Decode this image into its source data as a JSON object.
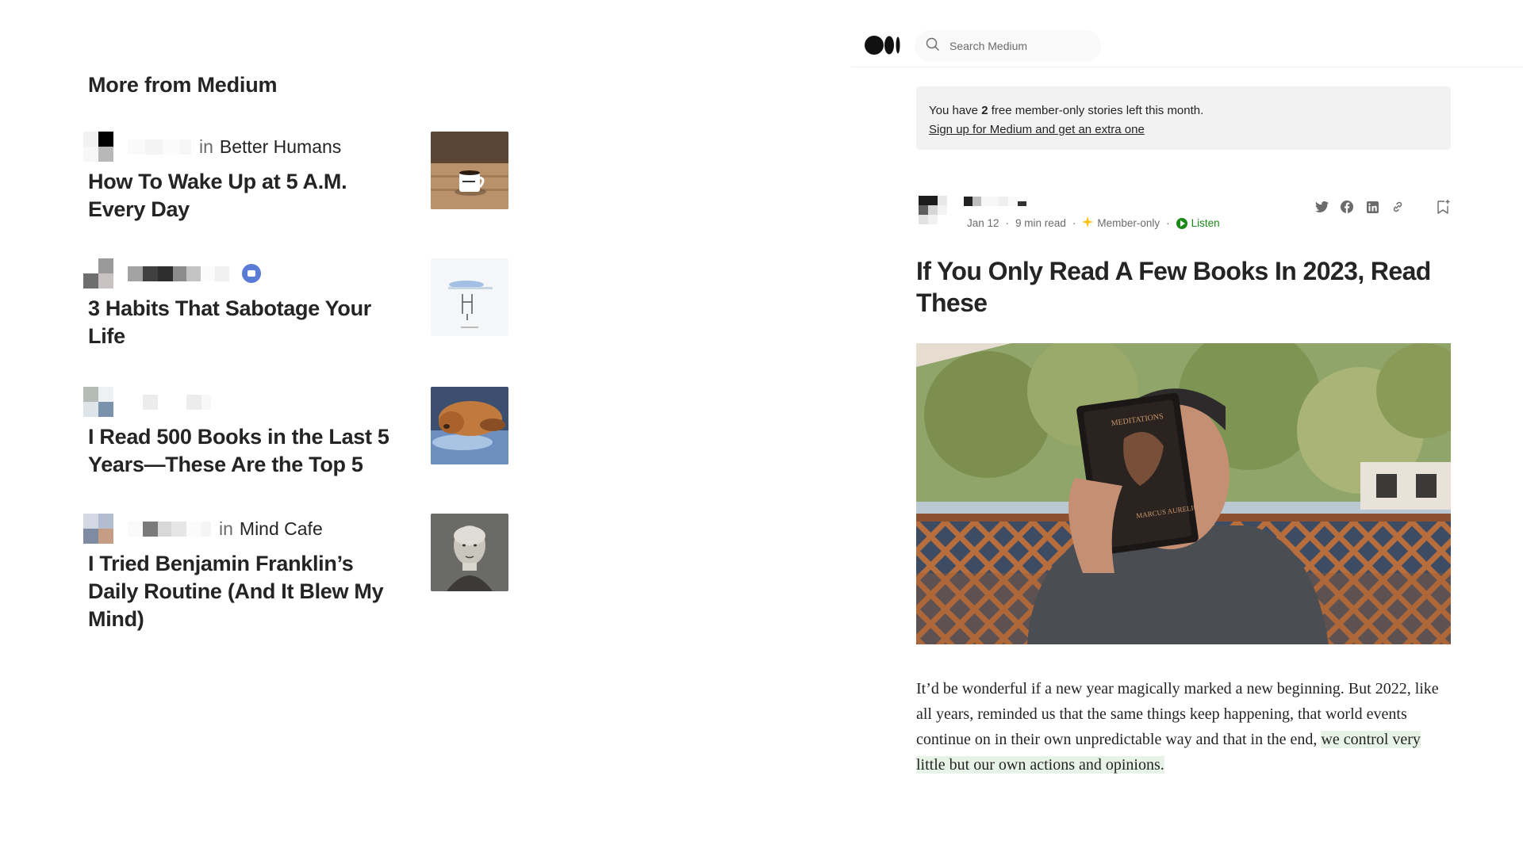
{
  "more_from_medium": {
    "title": "More from Medium",
    "stories": [
      {
        "publication_prefix": "in",
        "publication": "Better Humans",
        "title": "How To Wake Up at 5 A.M. Every Day",
        "thumb_icon": "coffee-cup-photo"
      },
      {
        "publication_prefix": "",
        "publication": "",
        "title": "3 Habits That Sabotage Your Life",
        "thumb_icon": "sketch-illustration"
      },
      {
        "publication_prefix": "",
        "publication": "",
        "title": "I Read 500 Books in the Last 5 Years—These Are the Top 5",
        "thumb_icon": "sleeping-dog-photo"
      },
      {
        "publication_prefix": "in",
        "publication": "Mind Cafe",
        "title": "I Tried Benjamin Franklin’s Daily Routine (And It Blew My Mind)",
        "thumb_icon": "benjamin-franklin-portrait"
      }
    ]
  },
  "topbar": {
    "search_placeholder": "Search Medium"
  },
  "banner": {
    "text_before": "You have ",
    "count": "2",
    "text_after": " free member-only stories left this month.",
    "link": "Sign up for Medium and get an extra one"
  },
  "article": {
    "date": "Jan 12",
    "read_time": "9 min read",
    "member_label": "Member-only",
    "listen_label": "Listen",
    "title": "If You Only Read A Few Books In 2023, Read These",
    "hero_book_title": "MEDITATIONS",
    "hero_book_author": "MARCUS AURELIUS",
    "body_plain": "It’d be wonderful if a new year magically marked a new beginning. But 2022, like all years, reminded us that the same things keep happening, that world events continue on in their own unpredictable way and that in the end, ",
    "body_highlight": "we control very little but our own actions and opinions."
  },
  "colors": {
    "text": "#242424",
    "muted": "#6b6b6b",
    "listen_green": "#1a8917",
    "member_star": "#ffc017",
    "banner_bg": "#f2f2f2",
    "highlight": "#e8f3e8"
  }
}
